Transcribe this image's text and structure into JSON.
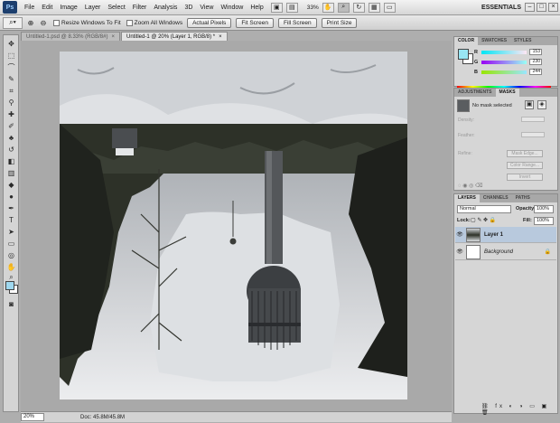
{
  "menubar": {
    "logo": "Ps",
    "items": [
      "File",
      "Edit",
      "Image",
      "Layer",
      "Select",
      "Filter",
      "Analysis",
      "3D",
      "View",
      "Window",
      "Help"
    ],
    "zoom": "33%",
    "workspace": "ESSENTIALS",
    "window_controls": [
      "–",
      "□",
      "×"
    ]
  },
  "options": {
    "resize_windows": "Resize Windows To Fit",
    "zoom_all": "Zoom All Windows",
    "buttons": [
      "Actual Pixels",
      "Fit Screen",
      "Fill Screen",
      "Print Size"
    ]
  },
  "tabs": [
    {
      "label": "Untitled-1.psd @ 8.33% (RGB/8#)",
      "close": "×"
    },
    {
      "label": "Untitled-1 @ 20% (Layer 1, RGB/8) *",
      "close": "×"
    }
  ],
  "statusbar": {
    "zoom": "20%",
    "doc": "Doc: 45.8M/45.8M"
  },
  "color_panel": {
    "tabs": [
      "COLOR",
      "SWATCHES",
      "STYLES"
    ],
    "r": "153",
    "g": "230",
    "b": "244",
    "r_frac": 0.6,
    "g_frac": 0.9,
    "b_frac": 0.96,
    "fg_color": "#99e6f4"
  },
  "adjustments_panel": {
    "tabs": [
      "ADJUSTMENTS",
      "MASKS"
    ],
    "no_mask": "No mask selected",
    "density": "Density:",
    "feather": "Feather:",
    "refine": "Refine:",
    "buttons": [
      "Mask Edge...",
      "Color Range...",
      "Invert"
    ]
  },
  "layers_panel": {
    "tabs": [
      "LAYERS",
      "CHANNELS",
      "PATHS"
    ],
    "blend_mode": "Normal",
    "opacity_label": "Opacity:",
    "opacity": "100%",
    "lock_label": "Lock:",
    "fill_label": "Fill:",
    "fill": "100%",
    "layers": [
      {
        "name": "Layer 1",
        "selected": true
      },
      {
        "name": "Background",
        "selected": false
      }
    ]
  }
}
